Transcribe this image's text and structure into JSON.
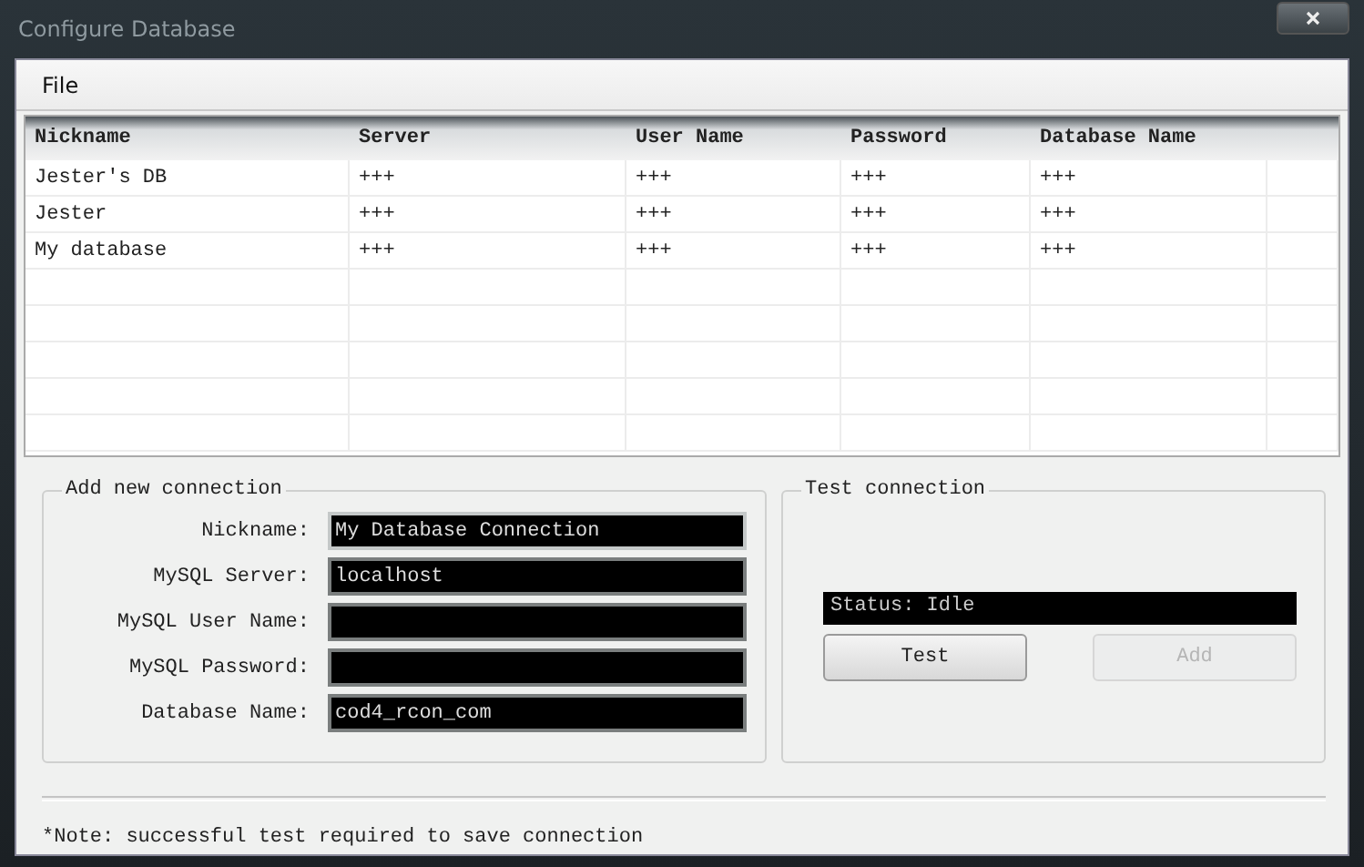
{
  "window": {
    "title": "Configure Database"
  },
  "menu": [
    "File"
  ],
  "table": {
    "columns": [
      "Nickname",
      "Server",
      "User Name",
      "Password",
      "Database Name"
    ],
    "rows": [
      [
        "Jester's DB",
        "+++",
        "+++",
        "+++",
        "+++"
      ],
      [
        "Jester",
        "+++",
        "+++",
        "+++",
        "+++"
      ],
      [
        "My database",
        "+++",
        "+++",
        "+++",
        "+++"
      ]
    ]
  },
  "add_connection": {
    "title": "Add new connection",
    "fields": [
      {
        "label": "Nickname:",
        "value": "My Database Connection",
        "focused": true
      },
      {
        "label": "MySQL Server:",
        "value": "localhost",
        "focused": false
      },
      {
        "label": "MySQL User Name:",
        "focused": false
      },
      {
        "label": "MySQL Password:",
        "focused": false
      },
      {
        "label": "Database Name:",
        "value": "cod4_rcon_com",
        "focused": false
      }
    ]
  },
  "test_connection": {
    "title": "Test connection",
    "status": "Status: Idle",
    "buttons": [
      {
        "label": "Test",
        "disabled": false
      },
      {
        "label": "Add",
        "disabled": true
      }
    ]
  },
  "note": "*Note: successful test required to save connection"
}
